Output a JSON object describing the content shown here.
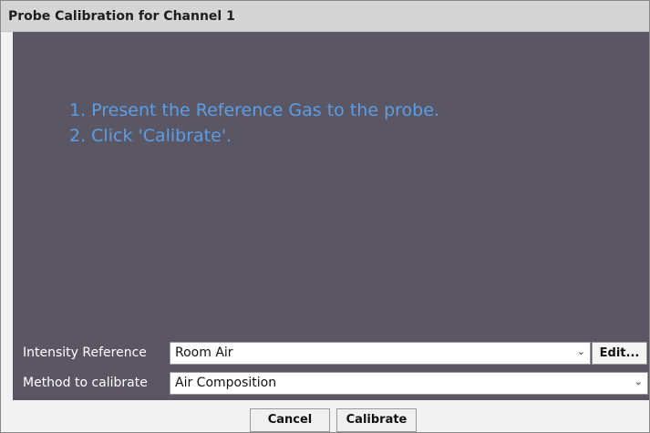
{
  "dialog": {
    "title": "Probe Calibration for Channel 1"
  },
  "instructions": [
    "1. Present the Reference Gas to the probe.",
    "2. Click 'Calibrate'."
  ],
  "form": {
    "intensity_reference": {
      "label": "Intensity Reference",
      "value": "Room Air",
      "edit_label": "Edit..."
    },
    "method": {
      "label": "Method to calibrate",
      "value": "Air Composition"
    }
  },
  "buttons": {
    "cancel": "Cancel",
    "calibrate": "Calibrate"
  },
  "icons": {
    "dropdown": "chevron-down-icon"
  },
  "colors": {
    "panel_bg": "#5a5663",
    "instruction_text": "#5c9ee6",
    "titlebar_bg": "#d5d5d5"
  }
}
